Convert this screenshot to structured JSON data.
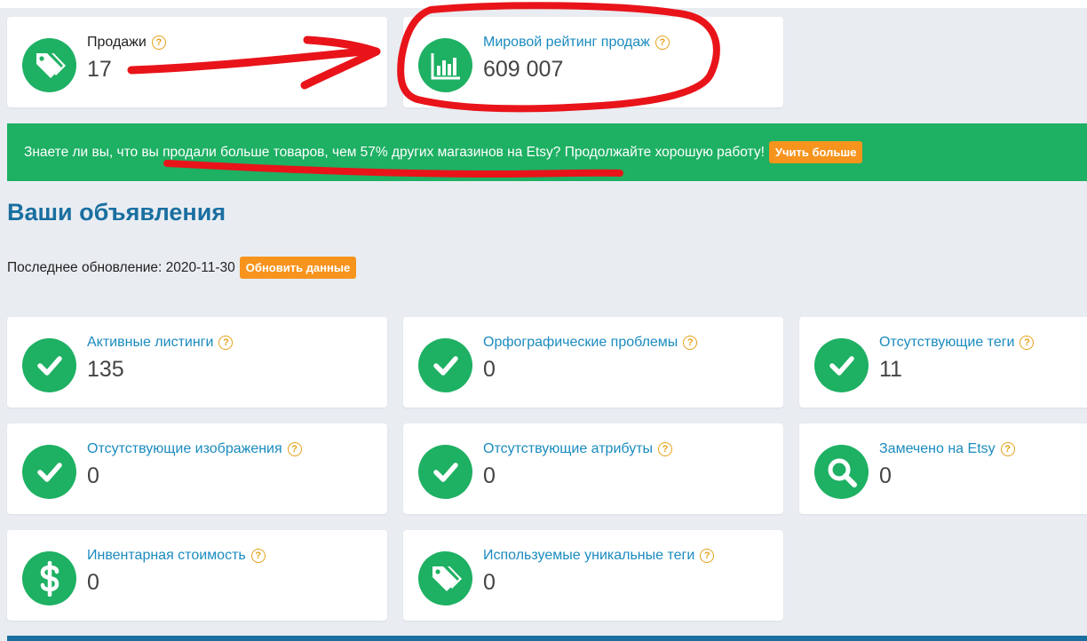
{
  "colors": {
    "accent_green": "#1eb063",
    "link_blue": "#1a8bbf",
    "heading_blue": "#1a6fa0",
    "button_orange": "#f7941d",
    "help_orange": "#e5a11a",
    "annotation_red": "#e8141a"
  },
  "top_cards": [
    {
      "icon": "price-tag-icon",
      "title": "Продажи",
      "value": "17"
    },
    {
      "icon": "bar-chart-icon",
      "title": "Мировой рейтинг продаж",
      "value": "609 007"
    }
  ],
  "banner": {
    "text": "Знаете ли вы, что вы продали больше товаров, чем 57% других магазинов на Etsy? Продолжайте хорошую работу!",
    "button_label": "Учить больше"
  },
  "listings": {
    "title": "Ваши объявления",
    "last_update_label": "Последнее обновление: 2020-11-30",
    "refresh_button_label": "Обновить данные",
    "cards": [
      {
        "icon": "checkmark-icon",
        "title": "Активные листинги",
        "value": "135"
      },
      {
        "icon": "checkmark-icon",
        "title": "Орфографические проблемы",
        "value": "0"
      },
      {
        "icon": "checkmark-icon",
        "title": "Отсутствующие теги",
        "value": "11"
      },
      {
        "icon": "checkmark-icon",
        "title": "Отсутствующие изображения",
        "value": "0"
      },
      {
        "icon": "checkmark-icon",
        "title": "Отсутствующие атрибуты",
        "value": "0"
      },
      {
        "icon": "search-icon",
        "title": "Замечено на Etsy",
        "value": "0"
      },
      {
        "icon": "dollar-icon",
        "title": "Инвентарная стоимость",
        "value": "0"
      },
      {
        "icon": "price-tag-icon",
        "title": "Используемые уникальные теги",
        "value": "0"
      }
    ]
  },
  "help_glyph": "?"
}
